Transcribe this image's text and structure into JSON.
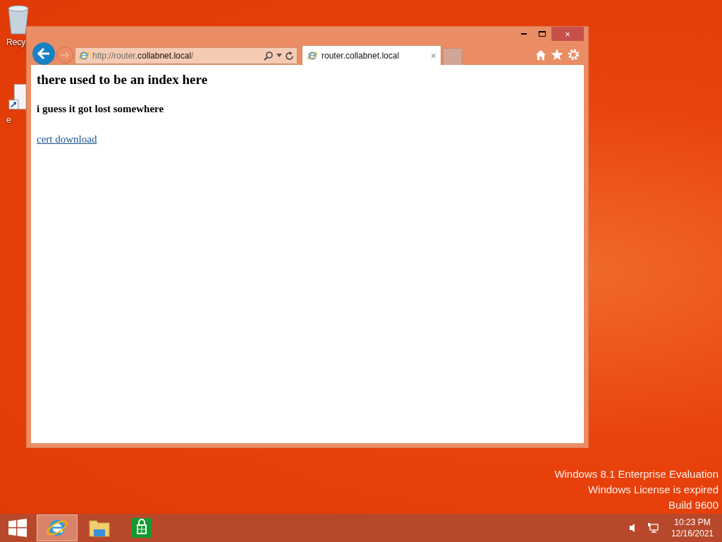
{
  "desktop_icons": [
    {
      "kind": "recycle",
      "label": "Recy"
    },
    {
      "kind": "file",
      "label": "e"
    }
  ],
  "browser": {
    "address": {
      "prefix": "http://router.",
      "domain": "collabnet.local",
      "suffix": "/"
    },
    "tabs": [
      {
        "title": "router.collabnet.local",
        "selected": true,
        "close": "×"
      }
    ],
    "page": {
      "heading": "there used to be an index here",
      "subheading": "i guess it got lost somewhere",
      "link": "cert download"
    },
    "window_close": "×"
  },
  "watermark_lines": [
    "Windows 8.1 Enterprise Evaluation",
    "Windows License is expired",
    "Build 9600"
  ],
  "taskbar": {
    "apps": [
      {
        "kind": "ie",
        "selected": true
      },
      {
        "kind": "explorer",
        "selected": false
      },
      {
        "kind": "store",
        "selected": false
      }
    ],
    "clock": {
      "time": "10:23 PM",
      "date": "12/16/2021"
    }
  }
}
